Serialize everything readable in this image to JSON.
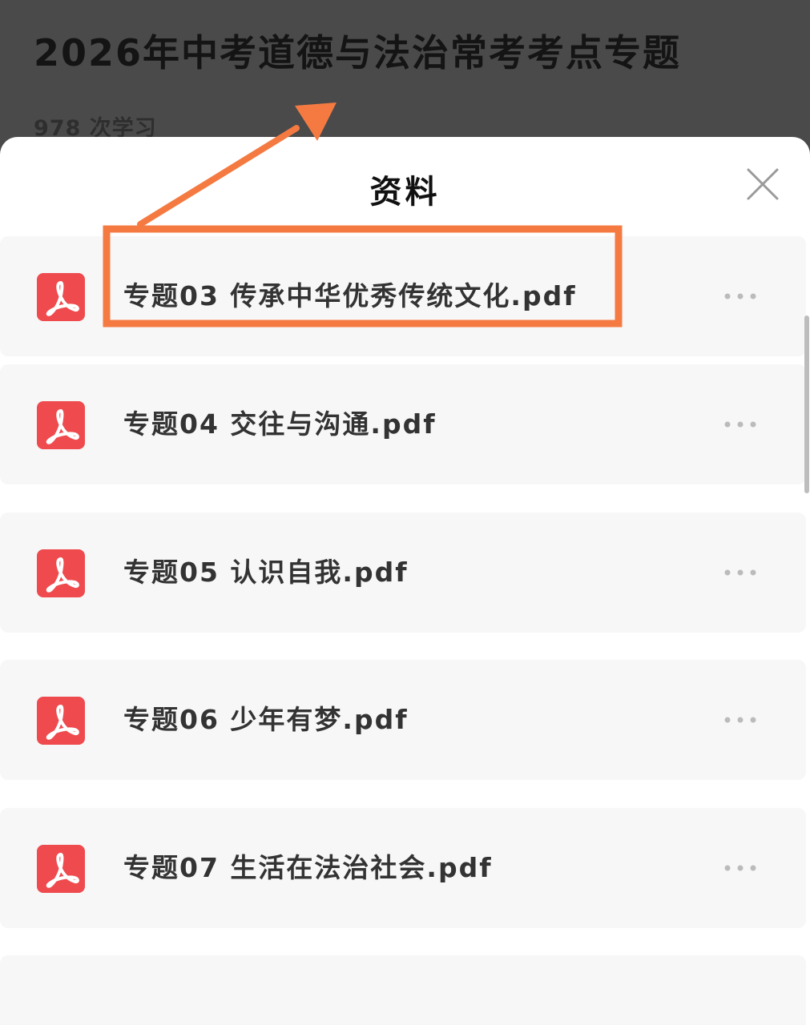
{
  "header": {
    "title": "2026年中考道德与法治常考考点专题",
    "study_count": "978 次学习"
  },
  "sheet": {
    "title": "资料",
    "close_icon": "close-icon",
    "files": [
      {
        "name": "专题03 传承中华优秀传统文化.pdf",
        "icon": "pdf-icon",
        "highlighted": true
      },
      {
        "name": "专题04 交往与沟通.pdf",
        "icon": "pdf-icon"
      },
      {
        "name": "专题05 认识自我.pdf",
        "icon": "pdf-icon"
      },
      {
        "name": "专题06 少年有梦.pdf",
        "icon": "pdf-icon"
      },
      {
        "name": "专题07 生活在法治社会.pdf",
        "icon": "pdf-icon"
      }
    ]
  },
  "colors": {
    "pdf_icon": "#ef4a4e",
    "annotation": "#f47a42",
    "overlay": "#4a4a4a"
  }
}
